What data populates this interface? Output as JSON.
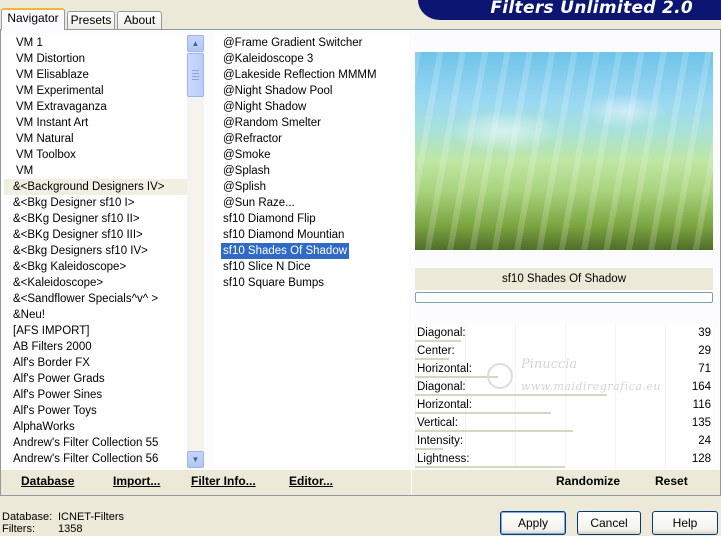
{
  "tabs": [
    {
      "label": "Navigator",
      "active": true
    },
    {
      "label": "Presets",
      "active": false
    },
    {
      "label": "About",
      "active": false
    }
  ],
  "title": "Filters Unlimited 2.0",
  "categories": [
    "VM 1",
    "VM Distortion",
    "VM Elisablaze",
    "VM Experimental",
    "VM Extravaganza",
    "VM Instant Art",
    "VM Natural",
    "VM Toolbox",
    "VM",
    "&<Background Designers IV>",
    "&<Bkg Designer sf10 I>",
    "&<BKg Designer sf10 II>",
    "&<BKg Designer sf10 III>",
    "&<Bkg Designers sf10 IV>",
    "&<Bkg Kaleidoscope>",
    "&<Kaleidoscope>",
    "&<Sandflower Specials^v^ >",
    "&Neu!",
    "[AFS IMPORT]",
    "AB Filters 2000",
    "Alf's Border FX",
    "Alf's Power Grads",
    "Alf's Power Sines",
    "Alf's Power Toys",
    "AlphaWorks",
    "Andrew's Filter Collection 55",
    "Andrew's Filter Collection 56"
  ],
  "filters": [
    "@Frame Gradient Switcher",
    "@Kaleidoscope 3",
    "@Lakeside Reflection MMMM",
    "@Night Shadow Pool",
    "@Night Shadow",
    "@Random Smelter",
    "@Refractor",
    "@Smoke",
    "@Splash",
    "@Splish",
    "@Sun Raze...",
    "sf10 Diamond Flip",
    "sf10 Diamond Mountian",
    "sf10 Shades Of Shadow",
    "sf10 Slice N Dice",
    "sf10 Square Bumps"
  ],
  "selected_filter": "sf10 Shades Of Shadow",
  "hover_category": "&<Background Designers IV>",
  "preview_label": "sf10 Shades Of Shadow",
  "params": [
    {
      "label": "Diagonal:",
      "value": 39
    },
    {
      "label": "Center:",
      "value": 29
    },
    {
      "label": "Horizontal:",
      "value": 71
    },
    {
      "label": "Diagonal:",
      "value": 164
    },
    {
      "label": "Horizontal:",
      "value": 116
    },
    {
      "label": "Vertical:",
      "value": 135
    },
    {
      "label": "Intensity:",
      "value": 24
    },
    {
      "label": "Lightness:",
      "value": 128
    }
  ],
  "actions": {
    "database": "Database",
    "import": "Import...",
    "filter_info": "Filter Info...",
    "editor": "Editor...",
    "randomize": "Randomize",
    "reset": "Reset"
  },
  "watermark": {
    "name": "Pinuccia",
    "url": "www.maidiregrafica.eu"
  },
  "status": {
    "database_label": "Database:",
    "database_value": "ICNET-Filters",
    "filters_label": "Filters:",
    "filters_value": "1358"
  },
  "buttons": {
    "apply": "Apply",
    "cancel": "Cancel",
    "help": "Help"
  }
}
